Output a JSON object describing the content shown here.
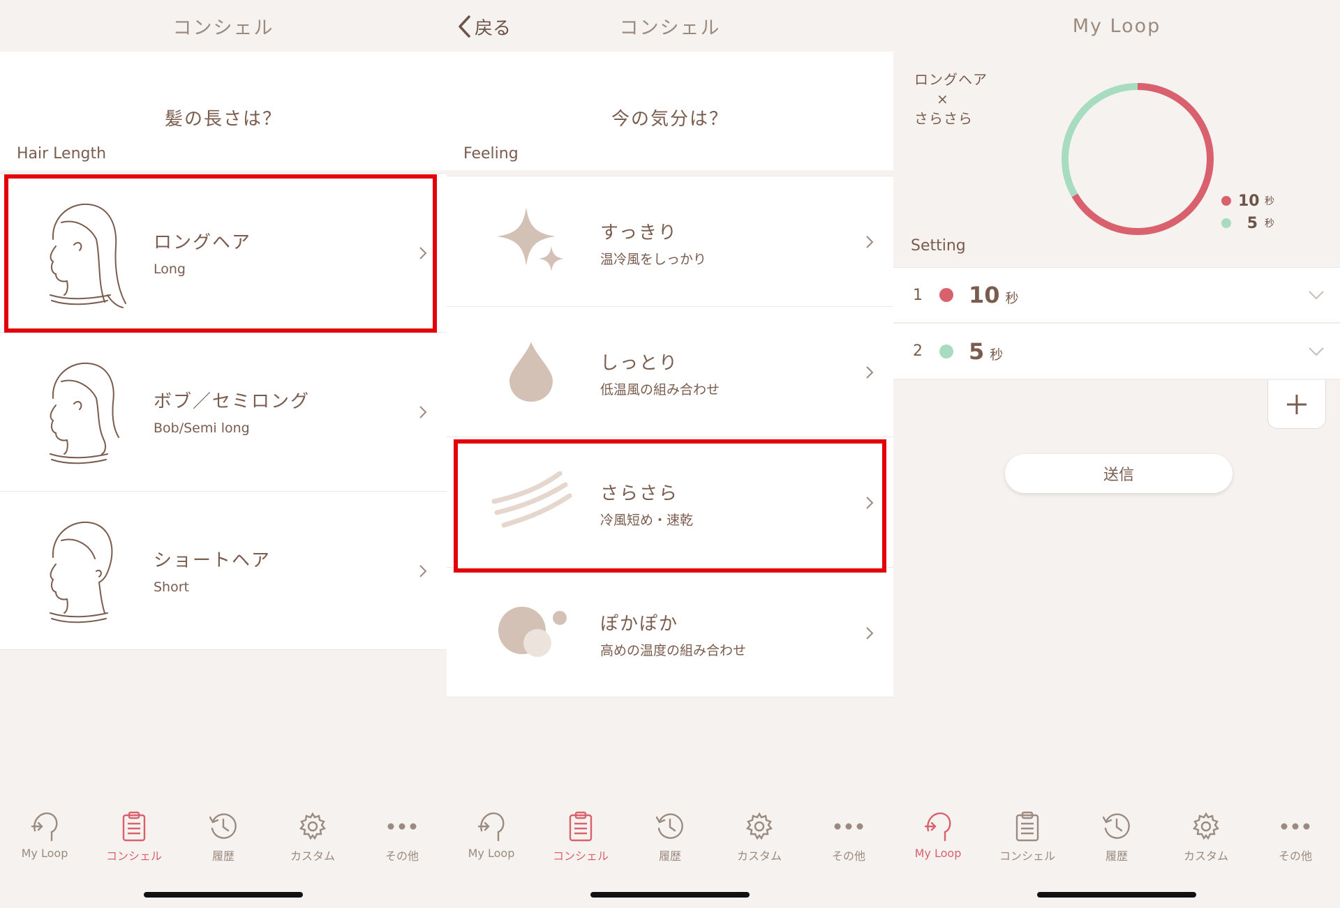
{
  "colors": {
    "accent": "#d8616d",
    "green": "#a8dcc0",
    "brown": "#7a5c4e",
    "highlight": "#e3000b"
  },
  "tabs": [
    {
      "label": "My Loop",
      "icon": "my-loop-icon"
    },
    {
      "label": "コンシェル",
      "icon": "clipboard-icon"
    },
    {
      "label": "履歴",
      "icon": "history-icon"
    },
    {
      "label": "カスタム",
      "icon": "gear-icon"
    },
    {
      "label": "その他",
      "icon": "more-icon"
    }
  ],
  "screen1": {
    "title": "コンシェル",
    "question": "髪の長さは？",
    "section_label": "Hair Length",
    "options": [
      {
        "title": "ロングヘア",
        "subtitle": "Long",
        "icon": "long-hair-icon"
      },
      {
        "title": "ボブ／セミロング",
        "subtitle": "Bob/Semi long",
        "icon": "bob-hair-icon"
      },
      {
        "title": "ショートヘア",
        "subtitle": "Short",
        "icon": "short-hair-icon"
      }
    ],
    "active_tab": "コンシェル"
  },
  "screen2": {
    "back_label": "戻る",
    "title": "コンシェル",
    "question": "今の気分は？",
    "section_label": "Feeling",
    "options": [
      {
        "title": "すっきり",
        "subtitle": "温冷風をしっかり",
        "icon": "sparkle-icon"
      },
      {
        "title": "しっとり",
        "subtitle": "低温風の組み合わせ",
        "icon": "drop-icon"
      },
      {
        "title": "さらさら",
        "subtitle": "冷風短め・速乾",
        "icon": "wind-lines-icon"
      },
      {
        "title": "ぽかぽか",
        "subtitle": "高めの温度の組み合わせ",
        "icon": "warm-circles-icon"
      }
    ],
    "active_tab": "コンシェル"
  },
  "screen3": {
    "title": "My Loop",
    "combo_line1": "ロングヘア",
    "combo_x": "×",
    "combo_line2": "さらさら",
    "setting_label": "Setting",
    "unit": "秒",
    "settings": [
      {
        "index": "1",
        "value": "10",
        "color": "#d8616d"
      },
      {
        "index": "2",
        "value": "5",
        "color": "#a8dcc0"
      }
    ],
    "send_label": "送信",
    "active_tab": "My Loop"
  },
  "chart_data": {
    "type": "pie",
    "categories": [
      "10秒",
      "5秒"
    ],
    "values": [
      10,
      5
    ],
    "colors": [
      "#d8616d",
      "#a8dcc0"
    ],
    "legend": "right"
  }
}
